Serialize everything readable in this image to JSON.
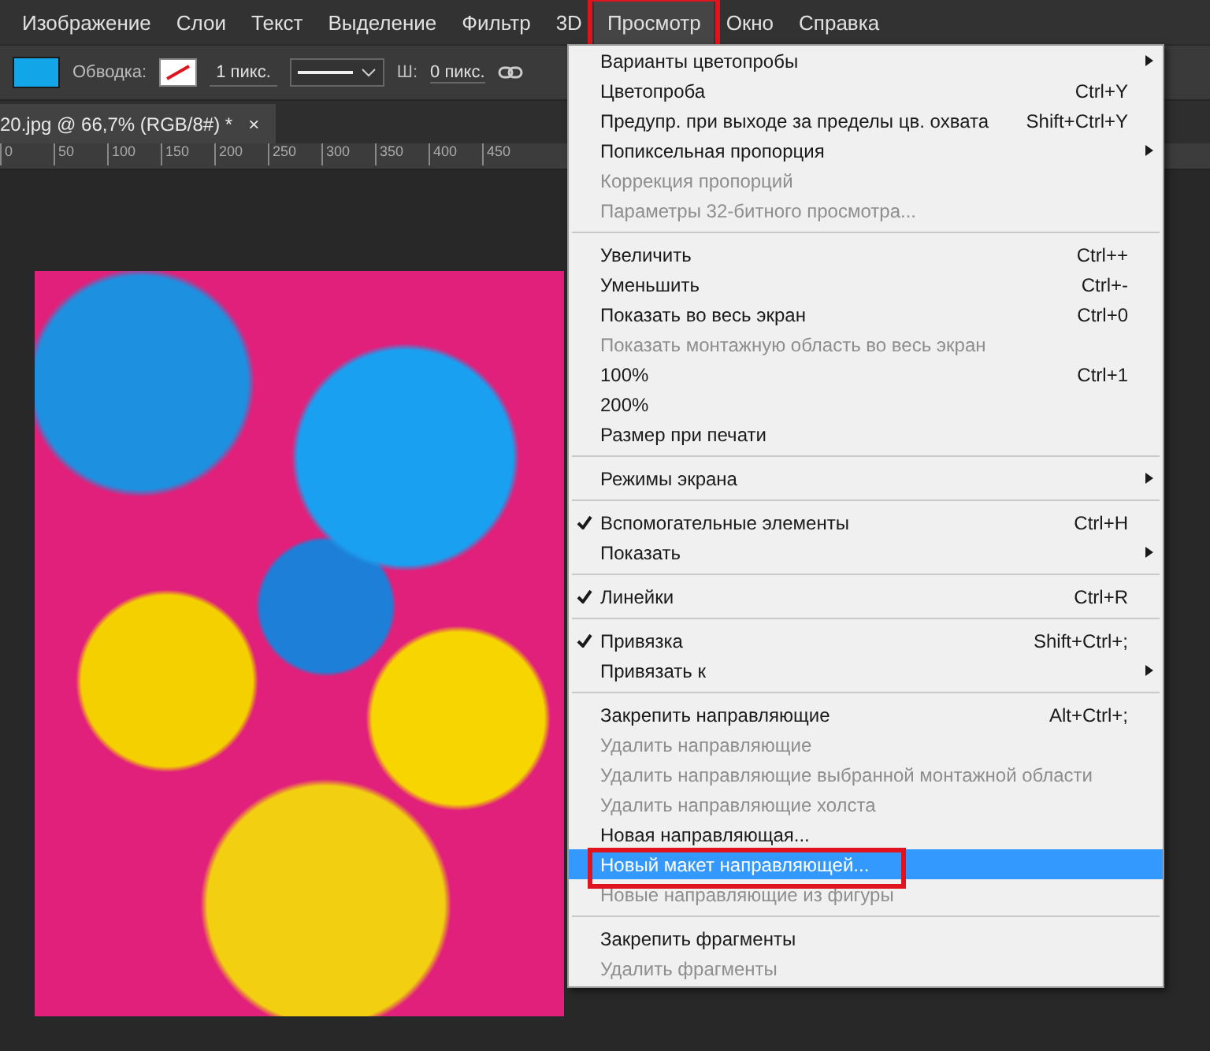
{
  "menubar": [
    {
      "label": "Изображение",
      "selected": false,
      "annotated": false
    },
    {
      "label": "Слои",
      "selected": false,
      "annotated": false
    },
    {
      "label": "Текст",
      "selected": false,
      "annotated": false
    },
    {
      "label": "Выделение",
      "selected": false,
      "annotated": false
    },
    {
      "label": "Фильтр",
      "selected": false,
      "annotated": false
    },
    {
      "label": "3D",
      "selected": false,
      "annotated": false
    },
    {
      "label": "Просмотр",
      "selected": true,
      "annotated": true
    },
    {
      "label": "Окно",
      "selected": false,
      "annotated": false
    },
    {
      "label": "Справка",
      "selected": false,
      "annotated": false
    }
  ],
  "options_bar": {
    "stroke_label": "Обводка:",
    "stroke_width": "1 пикс.",
    "width_label": "Ш:",
    "width_value": "0 пикс."
  },
  "document_tab": {
    "title": "20.jpg @ 66,7% (RGB/8#) *",
    "close": "×"
  },
  "ruler": [
    "0",
    "50",
    "100",
    "150",
    "200",
    "250",
    "300",
    "350",
    "400",
    "450"
  ],
  "menu": [
    {
      "kind": "item",
      "label": "Варианты цветопробы",
      "disabled": false,
      "checked": false,
      "submenu": true,
      "selected": false,
      "annotated": false
    },
    {
      "kind": "item",
      "label": "Цветопроба",
      "shortcut": "Ctrl+Y",
      "disabled": false,
      "checked": false,
      "submenu": false,
      "selected": false,
      "annotated": false
    },
    {
      "kind": "item",
      "label": "Предупр. при выходе за пределы цв. охвата",
      "shortcut": "Shift+Ctrl+Y",
      "disabled": false,
      "checked": false,
      "submenu": false,
      "selected": false,
      "annotated": false
    },
    {
      "kind": "item",
      "label": "Попиксельная пропорция",
      "disabled": false,
      "checked": false,
      "submenu": true,
      "selected": false,
      "annotated": false
    },
    {
      "kind": "item",
      "label": "Коррекция пропорций",
      "disabled": true,
      "checked": false,
      "submenu": false,
      "selected": false,
      "annotated": false
    },
    {
      "kind": "item",
      "label": "Параметры 32-битного просмотра...",
      "disabled": true,
      "checked": false,
      "submenu": false,
      "selected": false,
      "annotated": false
    },
    {
      "kind": "separator"
    },
    {
      "kind": "item",
      "label": "Увеличить",
      "shortcut": "Ctrl++",
      "disabled": false,
      "checked": false,
      "submenu": false,
      "selected": false,
      "annotated": false
    },
    {
      "kind": "item",
      "label": "Уменьшить",
      "shortcut": "Ctrl+-",
      "disabled": false,
      "checked": false,
      "submenu": false,
      "selected": false,
      "annotated": false
    },
    {
      "kind": "item",
      "label": "Показать во весь экран",
      "shortcut": "Ctrl+0",
      "disabled": false,
      "checked": false,
      "submenu": false,
      "selected": false,
      "annotated": false
    },
    {
      "kind": "item",
      "label": "Показать монтажную область во весь экран",
      "disabled": true,
      "checked": false,
      "submenu": false,
      "selected": false,
      "annotated": false
    },
    {
      "kind": "item",
      "label": "100%",
      "shortcut": "Ctrl+1",
      "disabled": false,
      "checked": false,
      "submenu": false,
      "selected": false,
      "annotated": false
    },
    {
      "kind": "item",
      "label": "200%",
      "disabled": false,
      "checked": false,
      "submenu": false,
      "selected": false,
      "annotated": false
    },
    {
      "kind": "item",
      "label": "Размер при печати",
      "disabled": false,
      "checked": false,
      "submenu": false,
      "selected": false,
      "annotated": false
    },
    {
      "kind": "separator"
    },
    {
      "kind": "item",
      "label": "Режимы экрана",
      "disabled": false,
      "checked": false,
      "submenu": true,
      "selected": false,
      "annotated": false
    },
    {
      "kind": "separator"
    },
    {
      "kind": "item",
      "label": "Вспомогательные элементы",
      "shortcut": "Ctrl+H",
      "disabled": false,
      "checked": true,
      "submenu": false,
      "selected": false,
      "annotated": false
    },
    {
      "kind": "item",
      "label": "Показать",
      "disabled": false,
      "checked": false,
      "submenu": true,
      "selected": false,
      "annotated": false
    },
    {
      "kind": "separator"
    },
    {
      "kind": "item",
      "label": "Линейки",
      "shortcut": "Ctrl+R",
      "disabled": false,
      "checked": true,
      "submenu": false,
      "selected": false,
      "annotated": false
    },
    {
      "kind": "separator"
    },
    {
      "kind": "item",
      "label": "Привязка",
      "shortcut": "Shift+Ctrl+;",
      "disabled": false,
      "checked": true,
      "submenu": false,
      "selected": false,
      "annotated": false
    },
    {
      "kind": "item",
      "label": "Привязать к",
      "disabled": false,
      "checked": false,
      "submenu": true,
      "selected": false,
      "annotated": false
    },
    {
      "kind": "separator"
    },
    {
      "kind": "item",
      "label": "Закрепить направляющие",
      "shortcut": "Alt+Ctrl+;",
      "disabled": false,
      "checked": false,
      "submenu": false,
      "selected": false,
      "annotated": false
    },
    {
      "kind": "item",
      "label": "Удалить направляющие",
      "disabled": true,
      "checked": false,
      "submenu": false,
      "selected": false,
      "annotated": false
    },
    {
      "kind": "item",
      "label": "Удалить направляющие выбранной монтажной области",
      "disabled": true,
      "checked": false,
      "submenu": false,
      "selected": false,
      "annotated": false
    },
    {
      "kind": "item",
      "label": "Удалить направляющие холста",
      "disabled": true,
      "checked": false,
      "submenu": false,
      "selected": false,
      "annotated": false
    },
    {
      "kind": "item",
      "label": "Новая направляющая...",
      "disabled": false,
      "checked": false,
      "submenu": false,
      "selected": false,
      "annotated": false
    },
    {
      "kind": "item",
      "label": "Новый макет направляющей...",
      "disabled": false,
      "checked": false,
      "submenu": false,
      "selected": true,
      "annotated": true
    },
    {
      "kind": "item",
      "label": "Новые направляющие из фигуры",
      "disabled": true,
      "checked": false,
      "submenu": false,
      "selected": false,
      "annotated": false
    },
    {
      "kind": "separator"
    },
    {
      "kind": "item",
      "label": "Закрепить фрагменты",
      "disabled": false,
      "checked": false,
      "submenu": false,
      "selected": false,
      "annotated": false
    },
    {
      "kind": "item",
      "label": "Удалить фрагменты",
      "disabled": true,
      "checked": false,
      "submenu": false,
      "selected": false,
      "annotated": false
    }
  ]
}
